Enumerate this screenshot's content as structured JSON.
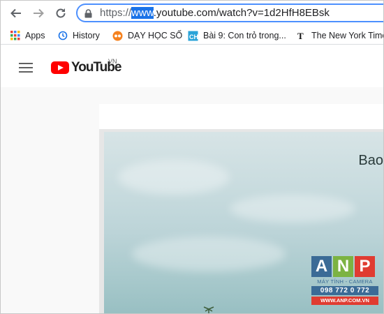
{
  "browser": {
    "url_prefix": "https://",
    "url_selected": "www",
    "url_rest": ".youtube.com/watch?v=1d2HfH8EBsk",
    "accent": "#1a73e8"
  },
  "bookmarks": [
    {
      "label": "Apps",
      "icon": "apps-grid-icon"
    },
    {
      "label": "History",
      "icon": "history-icon"
    },
    {
      "label": "DẠY HỌC SỐ",
      "icon": "dayhocso-icon"
    },
    {
      "label": "Bài 9: Con trỏ trong...",
      "icon": "ch-icon"
    },
    {
      "label": "The New York Time",
      "icon": "nyt-icon"
    }
  ],
  "youtube": {
    "logo_text": "YouTube",
    "region": "VN",
    "brand_color": "#ff0000"
  },
  "video": {
    "overlay_text": "Bao"
  },
  "watermark": {
    "letters": [
      "A",
      "N",
      "P"
    ],
    "letter_colors": [
      "#3b6b96",
      "#7cb342",
      "#e03c31"
    ],
    "subtitle": "MÁY TÍNH - CAMERA",
    "phone": "098 772 0 772",
    "site": "WWW.ANP.COM.VN"
  }
}
